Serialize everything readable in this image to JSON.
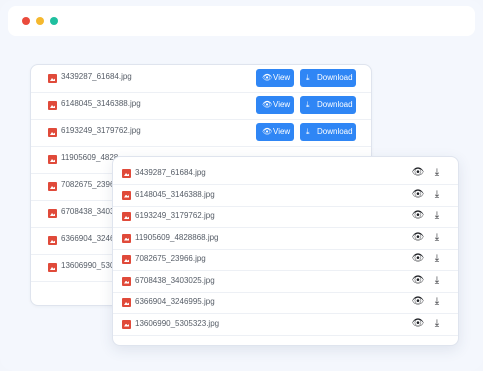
{
  "window": {
    "traffic_lights": [
      {
        "name": "close",
        "color": "#ea4b3c"
      },
      {
        "name": "minimize",
        "color": "#f5b82e"
      },
      {
        "name": "maximize",
        "color": "#1fbf9f"
      }
    ]
  },
  "back_panel": {
    "view_label": "View",
    "download_label": "Download",
    "files": [
      "3439287_61684.jpg",
      "6148045_3146388.jpg",
      "6193249_3179762.jpg",
      "11905609_4828",
      "7082675_2396",
      "6708438_3403",
      "6366904_3246",
      "13606990_530"
    ]
  },
  "front_panel": {
    "files": [
      "3439287_61684.jpg",
      "6148045_3146388.jpg",
      "6193249_3179762.jpg",
      "11905609_4828868.jpg",
      "7082675_23966.jpg",
      "6708438_3403025.jpg",
      "6366904_3246995.jpg",
      "13606990_5305323.jpg"
    ]
  },
  "icons": {
    "file": "image-file-icon",
    "view": "eye-icon",
    "download": "download-icon"
  },
  "colors": {
    "accent": "#2f86f5",
    "file_icon": "#e04a3a",
    "background": "#f4f7fd"
  }
}
